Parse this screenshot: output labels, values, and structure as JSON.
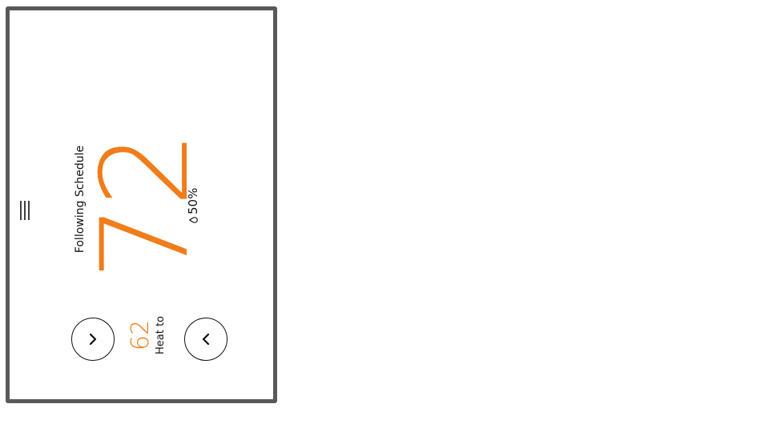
{
  "thermostat": {
    "humidity": "50%",
    "current_temperature": "72",
    "mode_status": "Following Schedule",
    "setpoint_label": "Heat to",
    "setpoint_value": "62",
    "icons": {
      "humidity": "water-drop-icon",
      "menu": "menu-icon",
      "increase": "chevron-right-icon",
      "decrease": "chevron-left-icon"
    },
    "colors": {
      "accent": "#f07d1a",
      "frame": "#595959",
      "text": "#111111",
      "background": "#ffffff"
    }
  }
}
